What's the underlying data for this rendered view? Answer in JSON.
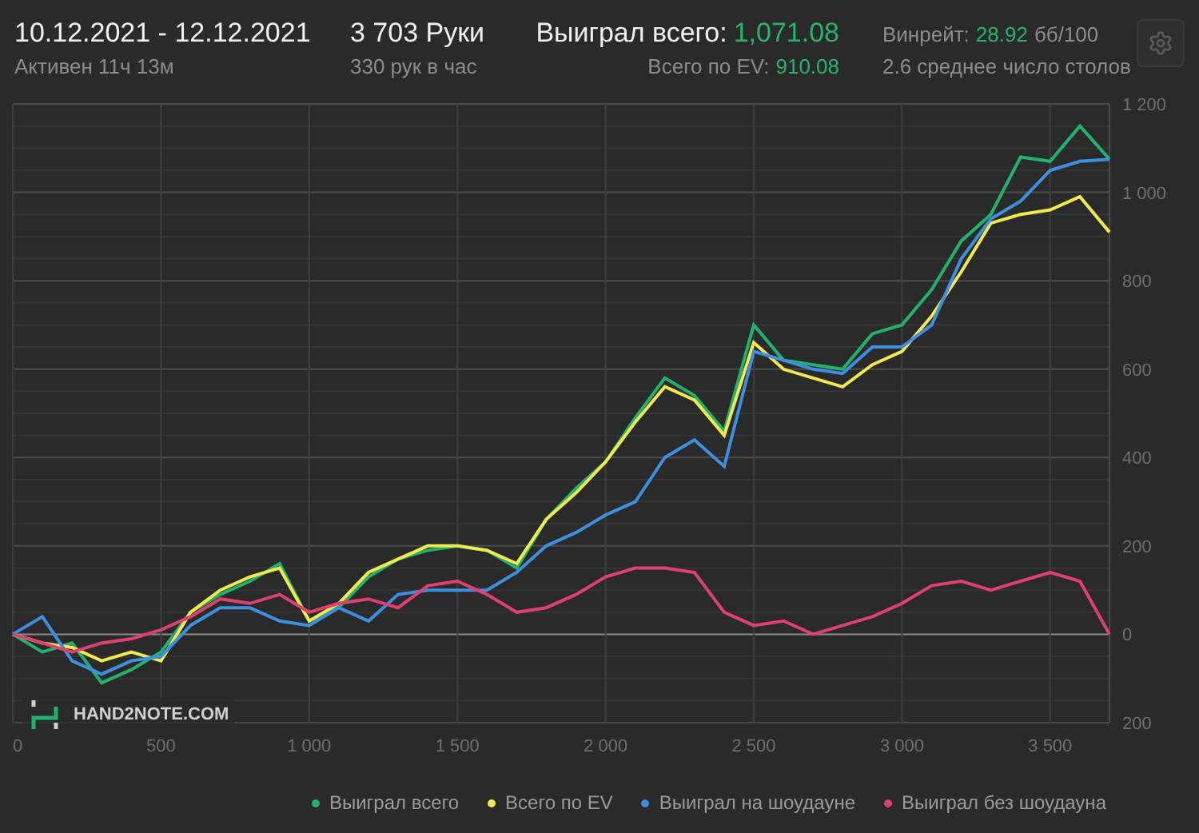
{
  "header": {
    "date_range": "10.12.2021 - 12.12.2021",
    "active": "Активен 11ч 13м",
    "hands": "3 703 Руки",
    "hands_per_hour": "330 рук в час",
    "won_label": "Выиграл всего:",
    "won_value": "1,071.08",
    "ev_label": "Всего по EV:",
    "ev_value": "910.08",
    "winrate_label": "Винрейт:",
    "winrate_value": "28.92",
    "winrate_unit": "бб/100",
    "tables": "2.6 среднее число столов"
  },
  "watermark": "HAND2NOTE.COM",
  "chart_data": {
    "type": "line",
    "grid": true,
    "x": [
      0,
      100,
      200,
      300,
      400,
      500,
      600,
      700,
      800,
      900,
      1000,
      1100,
      1200,
      1300,
      1400,
      1500,
      1600,
      1700,
      1800,
      1900,
      2000,
      2100,
      2200,
      2300,
      2400,
      2500,
      2600,
      2700,
      2800,
      2900,
      3000,
      3100,
      3200,
      3300,
      3400,
      3500,
      3600,
      3700
    ],
    "xlim": [
      0,
      3700
    ],
    "ylim": [
      -200,
      1200
    ],
    "xticks": [
      0,
      {
        "value": 500,
        "label": "500"
      },
      {
        "value": 1000,
        "label": "1 000"
      },
      {
        "value": 1500,
        "label": "1 500"
      },
      {
        "value": 2000,
        "label": "2 000"
      },
      {
        "value": 2500,
        "label": "2 500"
      },
      {
        "value": 3000,
        "label": "3 000"
      },
      {
        "value": 3500,
        "label": "3 500"
      }
    ],
    "yticks": [
      {
        "value": -200,
        "label": "200"
      },
      0,
      200,
      400,
      600,
      800,
      {
        "value": 1000,
        "label": "1 000"
      },
      {
        "value": 1200,
        "label": "1 200"
      }
    ],
    "series": [
      {
        "name": "Выиграл всего",
        "color": "#21b26e",
        "values": [
          0,
          -40,
          -20,
          -110,
          -80,
          -40,
          50,
          90,
          120,
          160,
          30,
          60,
          130,
          170,
          190,
          200,
          190,
          150,
          260,
          330,
          390,
          490,
          580,
          540,
          460,
          700,
          620,
          610,
          600,
          680,
          700,
          780,
          890,
          950,
          1080,
          1070,
          1150,
          1075
        ]
      },
      {
        "name": "Всего по EV",
        "color": "#f2e94e",
        "values": [
          0,
          -20,
          -30,
          -60,
          -40,
          -60,
          50,
          100,
          130,
          150,
          30,
          70,
          140,
          170,
          200,
          200,
          190,
          160,
          260,
          320,
          390,
          480,
          560,
          530,
          450,
          660,
          600,
          580,
          560,
          610,
          640,
          720,
          820,
          930,
          950,
          960,
          990,
          910
        ]
      },
      {
        "name": "Выиграл на шоудауне",
        "color": "#3d8fe0",
        "values": [
          0,
          40,
          -60,
          -90,
          -60,
          -50,
          20,
          60,
          60,
          30,
          20,
          60,
          30,
          90,
          100,
          100,
          100,
          140,
          200,
          230,
          270,
          300,
          400,
          440,
          380,
          640,
          620,
          600,
          590,
          650,
          650,
          700,
          850,
          940,
          980,
          1050,
          1070,
          1075
        ]
      },
      {
        "name": "Выиграл без шоудауна",
        "color": "#e0406f",
        "values": [
          0,
          -20,
          -40,
          -20,
          -10,
          10,
          40,
          80,
          70,
          90,
          50,
          70,
          80,
          60,
          110,
          120,
          90,
          50,
          60,
          90,
          130,
          150,
          150,
          140,
          50,
          20,
          30,
          0,
          20,
          40,
          70,
          110,
          120,
          100,
          120,
          140,
          120,
          0
        ]
      }
    ]
  }
}
